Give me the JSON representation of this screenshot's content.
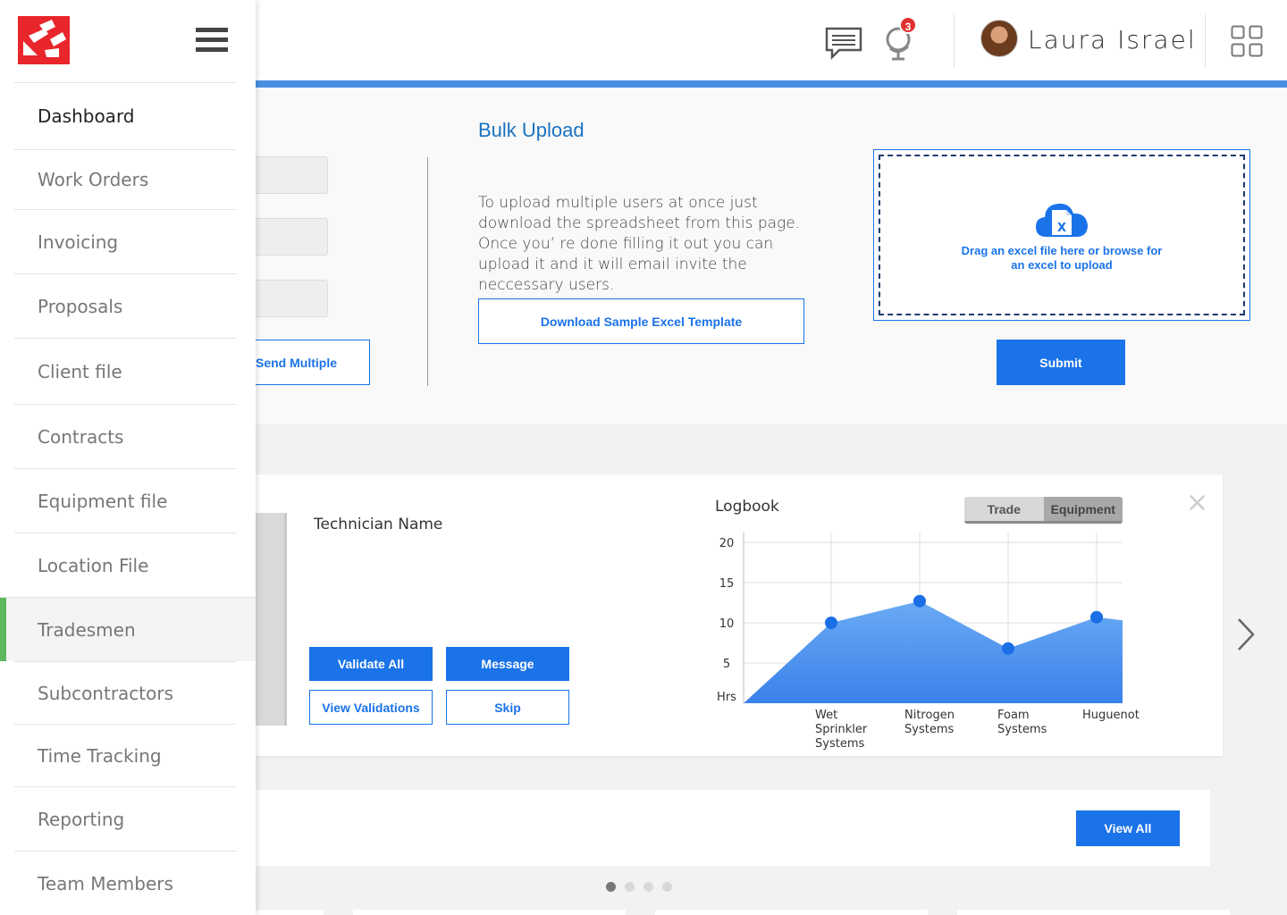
{
  "header": {
    "user_name": "Laura Israel",
    "notification_count": "3",
    "accent_color": "#4a90e2"
  },
  "sidebar": {
    "items": [
      {
        "label": "Dashboard"
      },
      {
        "label": "Work Orders"
      },
      {
        "label": "Invoicing"
      },
      {
        "label": "Proposals"
      },
      {
        "label": "Client file"
      },
      {
        "label": "Contracts"
      },
      {
        "label": "Equipment file"
      },
      {
        "label": "Location File"
      },
      {
        "label": "Tradesmen",
        "active": true
      },
      {
        "label": "Subcontractors"
      },
      {
        "label": "Time Tracking"
      },
      {
        "label": "Reporting"
      },
      {
        "label": "Team Members"
      }
    ],
    "active_color": "#5cb85c"
  },
  "invite": {
    "send_multiple_label": "Send Multiple"
  },
  "bulk_upload": {
    "title": "Bulk Upload",
    "description": "To upload multiple users at once just download the spreadsheet from this page. Once you’ re done filling it out you can upload it and it will email invite the neccessary users.",
    "download_label": "Download Sample Excel Template",
    "dropzone_text": "Drag an excel file here or browse for an excel to upload",
    "submit_label": "Submit"
  },
  "technician_card": {
    "name_label": "Technician Name",
    "validate_all_label": "Validate All",
    "message_label": "Message",
    "view_validations_label": "View Validations",
    "skip_label": "Skip",
    "close_symbol": "×",
    "logbook_title": "Logbook",
    "toggle": {
      "trade_label": "Trade",
      "equipment_label": "Equipment",
      "selected": "Equipment"
    }
  },
  "chart_data": {
    "type": "area",
    "title": "Logbook",
    "categories": [
      "Wet Sprinkler Systems",
      "Nitrogen Systems",
      "Foam Systems",
      "Huguenot"
    ],
    "values": [
      10,
      12.7,
      6.8,
      10.7
    ],
    "ylabel": "Hrs",
    "yticks": [
      20,
      15,
      10,
      5
    ],
    "ylim": [
      0,
      20
    ],
    "grid": true,
    "fill_color": "#5a9ef0",
    "point_color": "#1a6ee6"
  },
  "bottom": {
    "view_all_label": "View All",
    "pagination": {
      "count": 4,
      "active": 0
    }
  },
  "icons": [
    "chat-icon",
    "globe-icon",
    "apps-grid-icon",
    "cloud-excel-icon",
    "chevron-right-icon",
    "hamburger-icon",
    "logo-icon"
  ]
}
